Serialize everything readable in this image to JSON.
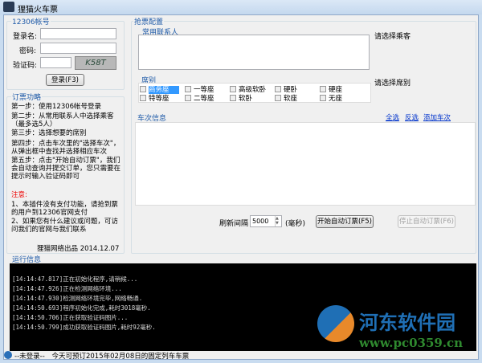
{
  "window": {
    "title": "狸猫火车票"
  },
  "account": {
    "group_label": "12306帐号",
    "username_label": "登录名:",
    "password_label": "密码:",
    "captcha_label": "验证码:",
    "captcha_image_text": "K58T",
    "username": "",
    "password": "",
    "captcha": "",
    "login_button": "登录(F3)"
  },
  "guide": {
    "group_label": "订票功略",
    "steps": [
      "第一步：使用12306帐号登录",
      "第二步：从常用联系人中选择乘客（最多选5人）",
      "第三步：选择想要的席别",
      "第四步：点击车次里的\"选择车次\"，从弹出框中查找并选择相应车次",
      "第五步：点击\"开始自动订票\"，我们会自动查询并提交订单，您只需要在提示时输入验证码即可"
    ],
    "notice_title": "注意:",
    "notices": [
      "1、本插件没有支付功能，请抢到票的用户到12306官网支付",
      "2、如果您有什么建议或问题，可访问我们的官网与我们联系"
    ],
    "footer": "狸猫网络出品 2014.12.07"
  },
  "config": {
    "group_label": "抢票配置",
    "contacts_label": "常用联系人",
    "contacts_hint": "请选择乘客",
    "seat_label": "席别",
    "seat_hint": "请选择席别",
    "seats": [
      "商务座",
      "一等座",
      "高级软卧",
      "硬卧",
      "硬座",
      "特等座",
      "二等座",
      "软卧",
      "软座",
      "无座"
    ],
    "train_label": "车次信息",
    "select_all": "全选",
    "invert": "反选",
    "add_train": "添加车次",
    "refresh_label": "刷新间隔",
    "refresh_value": "5000",
    "refresh_unit": "(毫秒)",
    "start_button": "开始自动订票(F5)",
    "stop_button": "停止自动订票(F6)"
  },
  "log": {
    "label": "运行信息",
    "lines": [
      "[14:14:47.817]正在初始化程序,请稍候...",
      "[14:14:47.926]正在检测网络环境...",
      "[14:14:47.930]检测网络环境完毕,网络畅通.",
      "[14:14:50.693]程序初始化完成,耗时3018毫秒.",
      "[14:14:50.706]正在获取验证码图片...",
      "[14:14:50.799]成功获取验证码图片,耗时92毫秒."
    ]
  },
  "status": {
    "login": "--未登录--",
    "message": "今天可预订2015年02月08日的固定列车车票"
  },
  "watermark": {
    "name": "河东软件园",
    "url": "www.pc0359.cn"
  }
}
